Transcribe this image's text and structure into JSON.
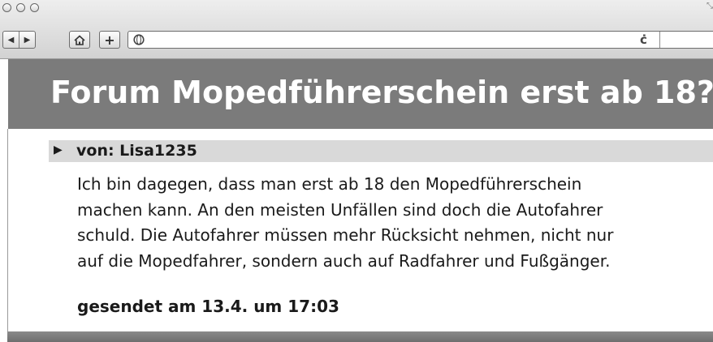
{
  "window": {
    "resize_glyph": "⤡"
  },
  "toolbar": {
    "back_icon": "◀",
    "forward_icon": "▶",
    "add_icon": "+",
    "reload_icon": "ċ",
    "address_value": ""
  },
  "page": {
    "title": "Forum Mopedführerschein erst ab 18?",
    "post": {
      "arrow": "▶",
      "author": "von: Lisa1235",
      "lines": [
        "Ich bin dagegen, dass man erst ab 18 den Mopedführerschein",
        "machen kann. An den meisten Unfällen sind doch die Autofahrer",
        "schuld. Die Autofahrer müssen mehr Rücksicht nehmen, nicht nur",
        "auf die Mopedfahrer, sondern auch auf Radfahrer und Fußgänger."
      ],
      "date": "gesendet am 13.4. um 17:03"
    }
  },
  "colors": {
    "banner_bg": "#7b7b7b",
    "post_header_bg": "#d9d9d9",
    "text": "#1a1a1a"
  }
}
